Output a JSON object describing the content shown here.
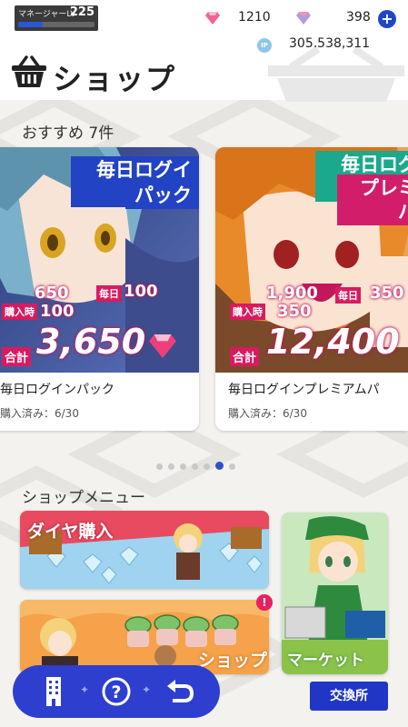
{
  "header": {
    "manager_label": "マネージャーLV",
    "manager_level": "225",
    "manager_progress": 0.32,
    "paid_gems": "1210",
    "free_gems": "398",
    "points": "305,538,311",
    "ip_icon_text": "IP",
    "title": "ショップ"
  },
  "recommend": {
    "heading": "おすすめ 7件",
    "cards": [
      {
        "banner_line1": "毎日ログイン",
        "banner_line2": "パック",
        "purchase_tag": "購入時",
        "purchase_amount": "650",
        "purchase_bonus": "100",
        "daily_tag": "毎日",
        "daily_amount": "100",
        "total_tag": "合計",
        "total_amount": "3,650",
        "name": "毎日ログインパック",
        "status": "購入済み：6/30"
      },
      {
        "banner_line1": "毎日ログイ",
        "banner_line2": "プレミア",
        "banner_line3": "パ",
        "purchase_tag": "購入時",
        "purchase_amount": "1,900",
        "purchase_bonus": "350",
        "daily_tag": "毎日",
        "daily_amount": "350",
        "total_tag": "合計",
        "total_amount": "12,400",
        "name": "毎日ログインプレミアムパ",
        "status": "購入済み：6/30"
      }
    ],
    "pager": {
      "count": 7,
      "active_index": 5
    }
  },
  "menu": {
    "heading": "ショップメニュー",
    "diamond_label": "ダイヤ購入",
    "shop_label": "ショップ",
    "market_label": "マーケット",
    "shop_badge": "!"
  },
  "nav": {
    "exchange_label": "交換所",
    "icons": [
      "building-icon",
      "help-icon",
      "back-icon"
    ]
  },
  "colors": {
    "accent": "#2e3fcf",
    "diamond_tile": "#e84a5f",
    "shop_tile": "#f39c3d",
    "market_tile": "#4caf50"
  }
}
